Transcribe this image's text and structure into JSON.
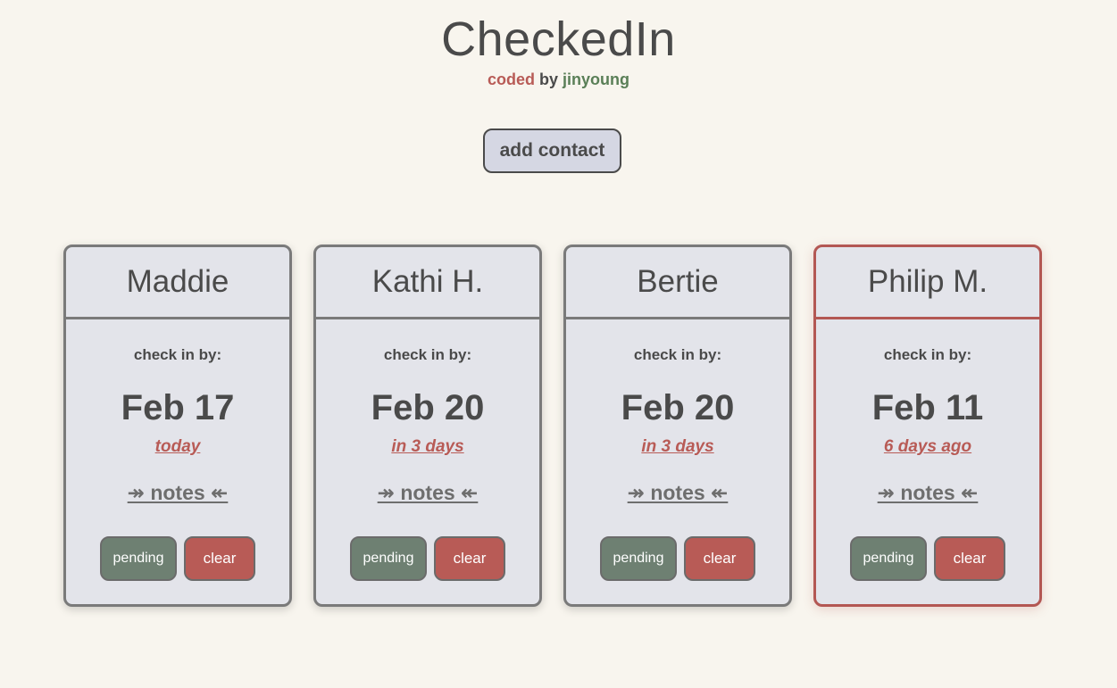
{
  "app": {
    "title": "CheckedIn",
    "credit": {
      "coded": "coded",
      "by": "by",
      "author": "jinyoung"
    }
  },
  "toolbar": {
    "add_contact_label": "add contact"
  },
  "colors": {
    "background": "#f8f5ee",
    "card": "#e3e4ea",
    "accent_red": "#b85b56",
    "accent_green": "#6e8072",
    "text": "#4a4a4a"
  },
  "cards": [
    {
      "name": "Maddie",
      "checkin_label": "check in by:",
      "date": "Feb 17",
      "relative": "today",
      "notes_label": "↠ notes ↞",
      "pending_label": "pending",
      "clear_label": "clear",
      "overdue": false
    },
    {
      "name": "Kathi H.",
      "checkin_label": "check in by:",
      "date": "Feb 20",
      "relative": "in 3 days",
      "notes_label": "↠ notes ↞",
      "pending_label": "pending",
      "clear_label": "clear",
      "overdue": false
    },
    {
      "name": "Bertie",
      "checkin_label": "check in by:",
      "date": "Feb 20",
      "relative": "in 3 days",
      "notes_label": "↠ notes ↞",
      "pending_label": "pending",
      "clear_label": "clear",
      "overdue": false
    },
    {
      "name": "Philip M.",
      "checkin_label": "check in by:",
      "date": "Feb 11",
      "relative": "6 days ago",
      "notes_label": "↠ notes ↞",
      "pending_label": "pending",
      "clear_label": "clear",
      "overdue": true
    }
  ]
}
